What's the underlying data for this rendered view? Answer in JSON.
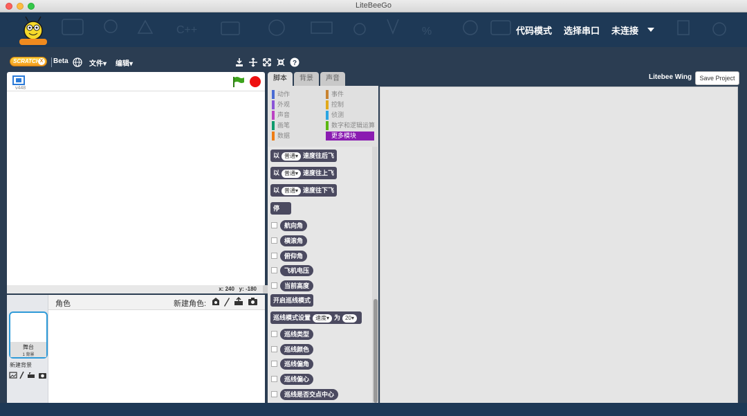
{
  "window": {
    "title": "LiteBeeGo"
  },
  "header": {
    "nav": [
      "代码模式",
      "选择串口",
      "未连接"
    ]
  },
  "menubar": {
    "logo_text": "SCRATCH",
    "beta": "Beta",
    "file": "文件▾",
    "edit": "编辑▾"
  },
  "stage": {
    "version": "v448",
    "coords": {
      "x_label": "x:",
      "x": "240",
      "y_label": "y:",
      "y": "-180"
    }
  },
  "sprites": {
    "label": "角色",
    "new_sprite": "新建角色:",
    "stage_name": "舞台",
    "stage_bg_count": "1 背景",
    "new_backdrop": "新建背景"
  },
  "tabs": [
    "脚本",
    "背景",
    "声音"
  ],
  "right": {
    "title": "Litebee Wing",
    "save": "Save Project"
  },
  "categories": {
    "left": [
      {
        "label": "动作",
        "color": "#4a6cd4"
      },
      {
        "label": "外观",
        "color": "#8a55d7"
      },
      {
        "label": "声音",
        "color": "#bb42c3"
      },
      {
        "label": "画笔",
        "color": "#0e9a6c"
      },
      {
        "label": "数据",
        "color": "#ee7d16"
      }
    ],
    "right": [
      {
        "label": "事件",
        "color": "#c88330"
      },
      {
        "label": "控制",
        "color": "#e1a91a"
      },
      {
        "label": "侦测",
        "color": "#2ca5e2"
      },
      {
        "label": "数字和逻辑运算",
        "color": "#5cb712"
      },
      {
        "label": "更多模块",
        "color": "#632d99"
      }
    ]
  },
  "blocks": {
    "move_back": {
      "pre": "以",
      "drop": "普通",
      "post": "速度往后飞"
    },
    "move_up": {
      "pre": "以",
      "drop": "普通",
      "post": "速度往上飞"
    },
    "move_down": {
      "pre": "以",
      "drop": "普通",
      "post": "速度往下飞"
    },
    "stop": "停",
    "reporters": [
      "航向角",
      "横滚角",
      "俯仰角",
      "飞机电压",
      "当前高度"
    ],
    "line_mode": "开启巡线模式",
    "line_set": {
      "pre": "巡线模式设置",
      "drop": "速度",
      "mid": "为",
      "val": "20"
    },
    "line_reporters": [
      "巡线类型",
      "巡线颜色",
      "巡线偏角",
      "巡线偏心",
      "巡线是否交点中心"
    ]
  }
}
